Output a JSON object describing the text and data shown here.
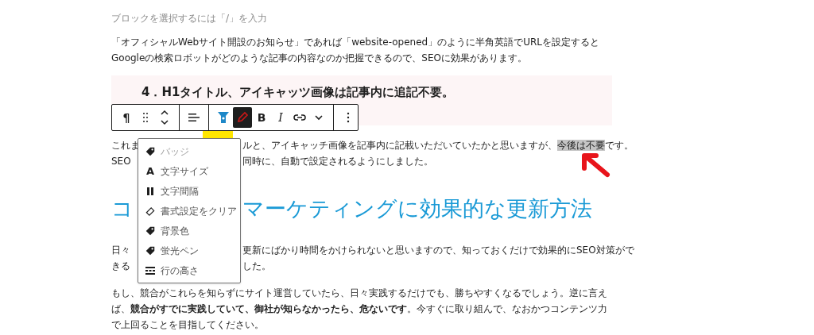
{
  "hint": "ブロックを選択するには「/」を入力",
  "intro": "「オフィシャルWebサイト開設のお知らせ」であれば「website-opened」のように半角英語でURLを設定するとGoogleの検索ロボットがどのような記事の内容なのか把握できるので、SEOに効果があります。",
  "heading_box": {
    "text": "4．H1タイトル、アイキャッツ画像は記事内に追記不要。"
  },
  "toolbar": {
    "items": [
      {
        "kind": "paragraph",
        "label": "¶",
        "selected": false
      },
      {
        "kind": "drag",
        "selected": false
      },
      {
        "kind": "move",
        "selected": false
      },
      {
        "kind": "align",
        "selected": false
      },
      {
        "kind": "custom",
        "selected": false
      },
      {
        "kind": "highlighter",
        "selected": true
      },
      {
        "kind": "bold",
        "label": "B",
        "selected": false
      },
      {
        "kind": "italic",
        "label": "I",
        "selected": false
      },
      {
        "kind": "link",
        "selected": false
      },
      {
        "kind": "chevron",
        "selected": false
      },
      {
        "kind": "more",
        "selected": false
      }
    ]
  },
  "menu": {
    "items": [
      {
        "kind": "tag",
        "label": "バッジ",
        "disabled": true
      },
      {
        "kind": "letter",
        "icon": "A",
        "label": "文字サイズ",
        "disabled": false
      },
      {
        "kind": "spacing",
        "label": "文字間隔",
        "disabled": false
      },
      {
        "kind": "eraser",
        "label": "書式設定をクリア",
        "disabled": false
      },
      {
        "kind": "tag",
        "label": "背景色",
        "disabled": false
      },
      {
        "kind": "tag",
        "label": "蛍光ペン",
        "disabled": false
      },
      {
        "kind": "lineheight",
        "label": "行の高さ",
        "disabled": false
      }
    ]
  },
  "para_covered": {
    "lines": [
      {
        "left": "これま",
        "right": [
          {
            "text": "ルと、アイキャッチ画像を記事内に記載いただいていたかと思いますが、",
            "highlighted": false
          },
          {
            "text": "今後は不要",
            "highlighted": true
          },
          {
            "text": "です。",
            "highlighted": false
          }
        ]
      },
      {
        "left": "SEO",
        "right": [
          {
            "text": "同時に、自動で設定されるようにしました。",
            "highlighted": false
          }
        ]
      }
    ]
  },
  "section_heading": {
    "left": "コ",
    "right": "マーケティングに効果的な更新方法"
  },
  "para_daily": {
    "lines": [
      {
        "left": "日々",
        "right": "更新にばかり時間をかけられないと思いますので、知っておくだけで効果的にSEO対策がで"
      },
      {
        "left": "きる",
        "right": "した。"
      }
    ]
  },
  "para_last": "もし、競合がこれらを知らずにサイト運営していたら、日々実践するだけでも、勝ちやすくなるでしょう。逆に言えば、**競合がすでに実践していて、御社が知らなかったら、危ないです**。今すぐに取り組んで、なおかつコンテンツ力で上回ることを目指してください。"
}
